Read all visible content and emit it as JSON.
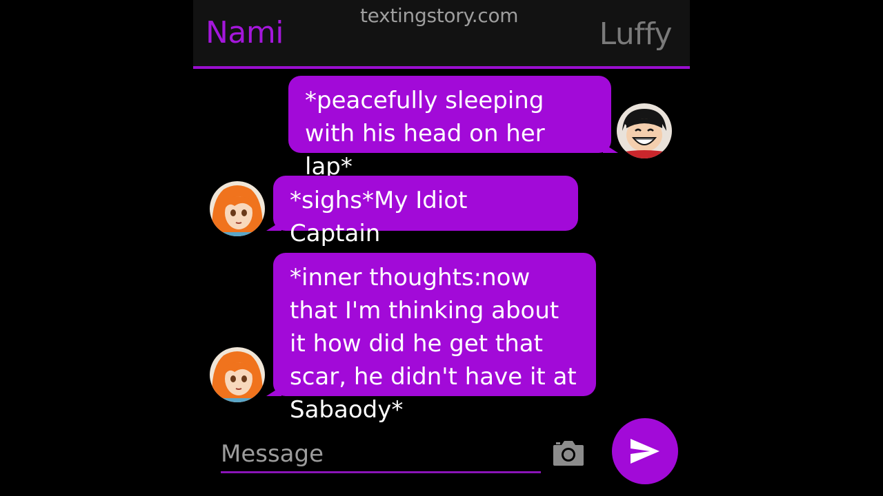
{
  "header": {
    "left_contact": "Nami",
    "right_contact": "Luffy",
    "watermark": "textingstory.com"
  },
  "messages": [
    {
      "sender": "Luffy",
      "side": "right",
      "text": "*peacefully sleeping with his head on her lap*"
    },
    {
      "sender": "Nami",
      "side": "left",
      "text": "*sighs*My Idiot Captain"
    },
    {
      "sender": "Nami",
      "side": "left",
      "text": "*inner thoughts:now that I'm thinking about it how did he get that scar, he didn't have it at Sabaody*"
    }
  ],
  "composer": {
    "placeholder": "Message"
  },
  "icons": {
    "camera": "camera-icon",
    "send": "send-icon"
  },
  "colors": {
    "accent": "#a20ad8",
    "header_bg": "#121212",
    "bubble_text": "#ffffff",
    "inactive_name": "#7a7a7a"
  }
}
